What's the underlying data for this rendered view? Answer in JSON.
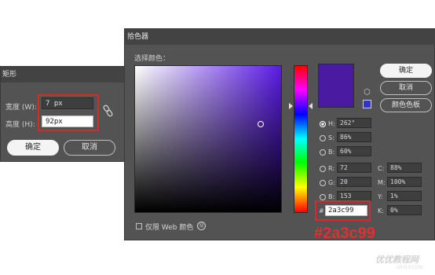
{
  "rect_dialog": {
    "title": "矩形",
    "width_label": "宽度 (W):",
    "width_value": "7 px",
    "height_label": "高度 (H):",
    "height_value": "92px",
    "link_icon": "chain-link-icon",
    "ok_label": "确定",
    "cancel_label": "取消"
  },
  "picker": {
    "title": "拾色器",
    "select_label": "选择颜色：",
    "ok_label": "确定",
    "cancel_label": "取消",
    "swatches_label": "颜色色板",
    "current_color": "#4a1aa0",
    "fields": {
      "H": {
        "label": "H:",
        "value": "262°"
      },
      "S": {
        "label": "S:",
        "value": "86%"
      },
      "B": {
        "label": "B:",
        "value": "60%"
      },
      "R": {
        "label": "R:",
        "value": "72"
      },
      "G": {
        "label": "G:",
        "value": "20"
      },
      "B2": {
        "label": "B:",
        "value": "153"
      },
      "C": {
        "label": "C:",
        "value": "88%"
      },
      "M": {
        "label": "M:",
        "value": "100%"
      },
      "Y": {
        "label": "Y:",
        "value": "1%"
      },
      "K": {
        "label": "K:",
        "value": "0%"
      }
    },
    "hex_prefix": "#",
    "hex_value": "2a3c99",
    "web_only_label": "仅限 Web 颜色",
    "web_only_icon": "Ⓠ"
  },
  "annotation": {
    "hex_text": "#2a3c99"
  },
  "watermark": {
    "main": "优优教程网",
    "sub": "UIUIUI.COM"
  },
  "colors": {
    "dialog_bg": "#535353",
    "titlebar_bg": "#434343",
    "highlight_red": "#d52b2b",
    "selected_color": "#4a1aa0"
  }
}
